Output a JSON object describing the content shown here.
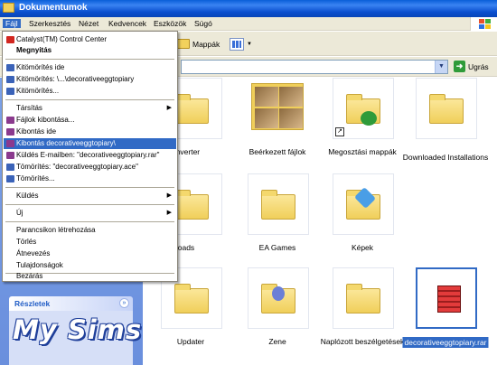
{
  "window": {
    "title": "Dokumentumok"
  },
  "menubar": {
    "items": [
      "Fájl",
      "Szerkesztés",
      "Nézet",
      "Kedvencek",
      "Eszközök",
      "Súgó"
    ]
  },
  "toolbar": {
    "folders_label": "Mappák"
  },
  "addressbar": {
    "go_label": "Ugrás"
  },
  "file_menu": {
    "catalyst": "Catalyst(TM) Control Center",
    "open": "Megnyitás",
    "extract_here": "Kitömörítés ide",
    "extract_to_path": "Kitömörítés: \\...\\decorativeeggtopiary",
    "extract_dots": "Kitömörítés...",
    "open_with": "Társítás",
    "unpack_files": "Fájlok kibontása...",
    "unpack_here": "Kibontás ide",
    "unpack_to": "Kibontás decorativeeggtopiary\\",
    "email": "Küldés E-mailben: \"decorativeeggtopiary.rar\"",
    "compress_ace": "Tömörítés: \"decorativeeggtopiary.ace\"",
    "compress": "Tömörítés...",
    "send_to": "Küldés",
    "new": "Új",
    "shortcut": "Parancsikon létrehozása",
    "delete": "Törlés",
    "rename": "Átnevezés",
    "properties": "Tulajdonságok",
    "close": "Bezárás"
  },
  "taskpane": {
    "details_label": "Részletek",
    "logo_text": "My Sims"
  },
  "files": [
    {
      "name": "eo Converter"
    },
    {
      "name": "Beérkezett fájlok"
    },
    {
      "name": "Megosztási mappák"
    },
    {
      "name": "Downloaded Installations"
    },
    {
      "name": "wnloads"
    },
    {
      "name": "EA Games"
    },
    {
      "name": "Képek"
    },
    {
      "name": "Updater"
    },
    {
      "name": "Zene"
    },
    {
      "name": "Naplózott beszélgetések"
    },
    {
      "name": "decorativeeggtopiary.rar"
    }
  ],
  "colors": {
    "selection": "#316ac5",
    "titlebar": "#0a5fd8",
    "menubar_bg": "#ece9d8"
  }
}
